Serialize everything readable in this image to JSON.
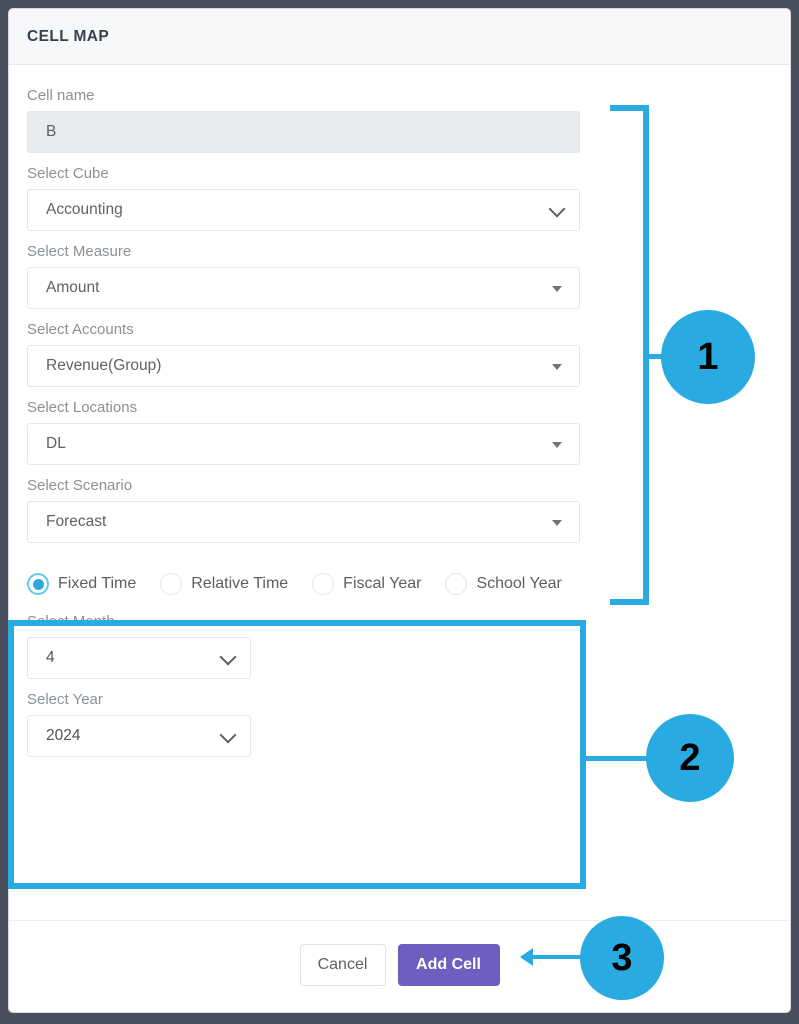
{
  "modal": {
    "title": "CELL MAP",
    "fields": [
      {
        "label": "Cell name",
        "value": "B",
        "control": "text-readonly"
      },
      {
        "label": "Select Cube",
        "value": "Accounting",
        "control": "select-chevron"
      },
      {
        "label": "Select Measure",
        "value": "Amount",
        "control": "select-caret"
      },
      {
        "label": "Select Accounts",
        "value": "Revenue(Group)",
        "control": "select-caret"
      },
      {
        "label": "Select Locations",
        "value": "DL",
        "control": "select-caret"
      },
      {
        "label": "Select Scenario",
        "value": "Forecast",
        "control": "select-caret"
      }
    ],
    "time_section": {
      "radios": [
        {
          "label": "Fixed Time",
          "selected": true
        },
        {
          "label": "Relative Time",
          "selected": false
        },
        {
          "label": "Fiscal Year",
          "selected": false
        },
        {
          "label": "School Year",
          "selected": false
        }
      ],
      "month": {
        "label": "Select Month",
        "value": "4"
      },
      "year": {
        "label": "Select Year",
        "value": "2024"
      }
    },
    "footer": {
      "cancel_label": "Cancel",
      "submit_label": "Add Cell"
    }
  },
  "annotations": {
    "accent_color": "#29abe2",
    "markers": [
      {
        "id": "1",
        "number": "1"
      },
      {
        "id": "2",
        "number": "2"
      },
      {
        "id": "3",
        "number": "3"
      }
    ]
  }
}
